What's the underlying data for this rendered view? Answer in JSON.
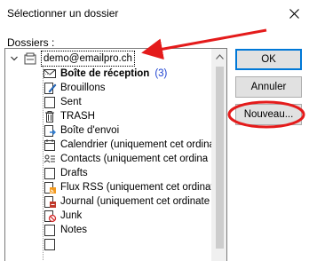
{
  "window": {
    "title": "Sélectionner un dossier"
  },
  "labels": {
    "folders": "Dossiers :"
  },
  "tree": {
    "root": {
      "label": "demo@emailpro.ch",
      "icon": "mailbox-icon"
    },
    "items": [
      {
        "label": "Boîte de réception",
        "count": "(3)",
        "bold": true,
        "icon": "inbox-icon"
      },
      {
        "label": "Brouillons",
        "icon": "drafts-pencil-icon"
      },
      {
        "label": "Sent",
        "icon": "folder-icon"
      },
      {
        "label": "TRASH",
        "icon": "trash-icon"
      },
      {
        "label": "Boîte d'envoi",
        "icon": "outbox-icon"
      },
      {
        "label": "Calendrier (uniquement cet ordina",
        "icon": "calendar-icon"
      },
      {
        "label": "Contacts (uniquement cet ordina",
        "icon": "contacts-icon"
      },
      {
        "label": "Drafts",
        "icon": "folder-icon"
      },
      {
        "label": "Flux RSS (uniquement cet ordinat",
        "icon": "rss-icon"
      },
      {
        "label": "Journal (uniquement cet ordinate",
        "icon": "journal-icon"
      },
      {
        "label": "Junk",
        "icon": "junk-icon"
      },
      {
        "label": "Notes",
        "icon": "notes-icon"
      }
    ]
  },
  "buttons": {
    "ok": "OK",
    "cancel": "Annuler",
    "new": "Nouveau..."
  },
  "colors": {
    "annotation": "#e41b1b",
    "focus": "#0078d7",
    "unread_count": "#1a3fd0"
  }
}
